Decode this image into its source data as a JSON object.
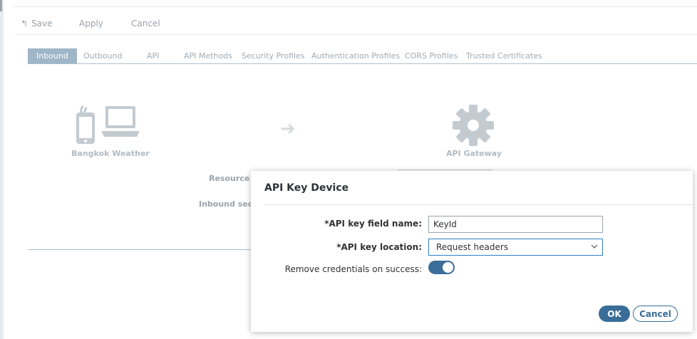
{
  "toolbar": {
    "save_label": "Save",
    "apply_label": "Apply",
    "cancel_label": "Cancel"
  },
  "tabs": [
    {
      "label": "Inbound",
      "active": true
    },
    {
      "label": "Outbound",
      "active": false
    },
    {
      "label": "API",
      "active": false
    },
    {
      "label": "API Methods",
      "active": false
    },
    {
      "label": "Security Profiles",
      "active": false
    },
    {
      "label": "Authentication Profiles",
      "active": false
    },
    {
      "label": "CORS Profiles",
      "active": false
    },
    {
      "label": "Trusted Certificates",
      "active": false
    }
  ],
  "diagram": {
    "client_label": "Bangkok Weather",
    "gateway_label": "API Gateway",
    "arrow_icon": "arrow-right-icon",
    "client_icon": "mobile-laptop-icon",
    "gateway_icon": "gear-icon"
  },
  "background_fields": {
    "resource_label": "Resource p",
    "inbound_security_label": "Inbound secu"
  },
  "dialog": {
    "title": "API Key Device",
    "key_field_label": "*API key field name:",
    "key_field_value": "KeyId",
    "key_location_label": "*API key location:",
    "key_location_value": "Request headers",
    "remove_credentials_label": "Remove credentials on success:",
    "remove_credentials_on": true,
    "ok_label": "OK",
    "cancel_label": "Cancel"
  },
  "colors": {
    "accent": "#3a6e99",
    "tab_active": "#9fb6c8",
    "muted_text": "#97a2ab"
  }
}
